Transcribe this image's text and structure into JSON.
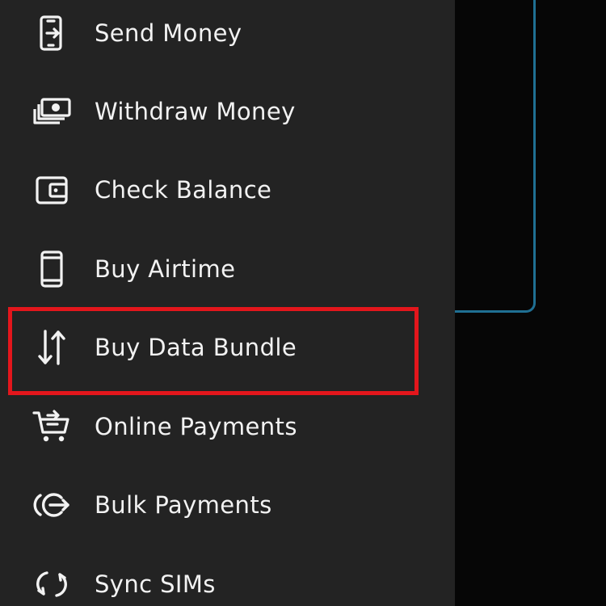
{
  "drawer": {
    "items": [
      {
        "label": "Send Money",
        "icon": "phone-send-icon"
      },
      {
        "label": "Withdraw Money",
        "icon": "cash-stack-icon"
      },
      {
        "label": "Check Balance",
        "icon": "wallet-icon"
      },
      {
        "label": "Buy Airtime",
        "icon": "phone-icon"
      },
      {
        "label": "Buy Data Bundle",
        "icon": "data-transfer-arrows-icon"
      },
      {
        "label": "Online Payments",
        "icon": "shopping-cart-icon"
      },
      {
        "label": "Bulk Payments",
        "icon": "bulk-payment-arrow-icon"
      },
      {
        "label": "Sync SIMs",
        "icon": "sync-icon"
      }
    ],
    "highlighted_item": "Buy Data Bundle"
  },
  "colors": {
    "drawer_background": "#232323",
    "screen_background": "#060606",
    "text": "#f2f2f2",
    "highlight_border": "#e3161c",
    "card_border": "#1f6f93"
  }
}
